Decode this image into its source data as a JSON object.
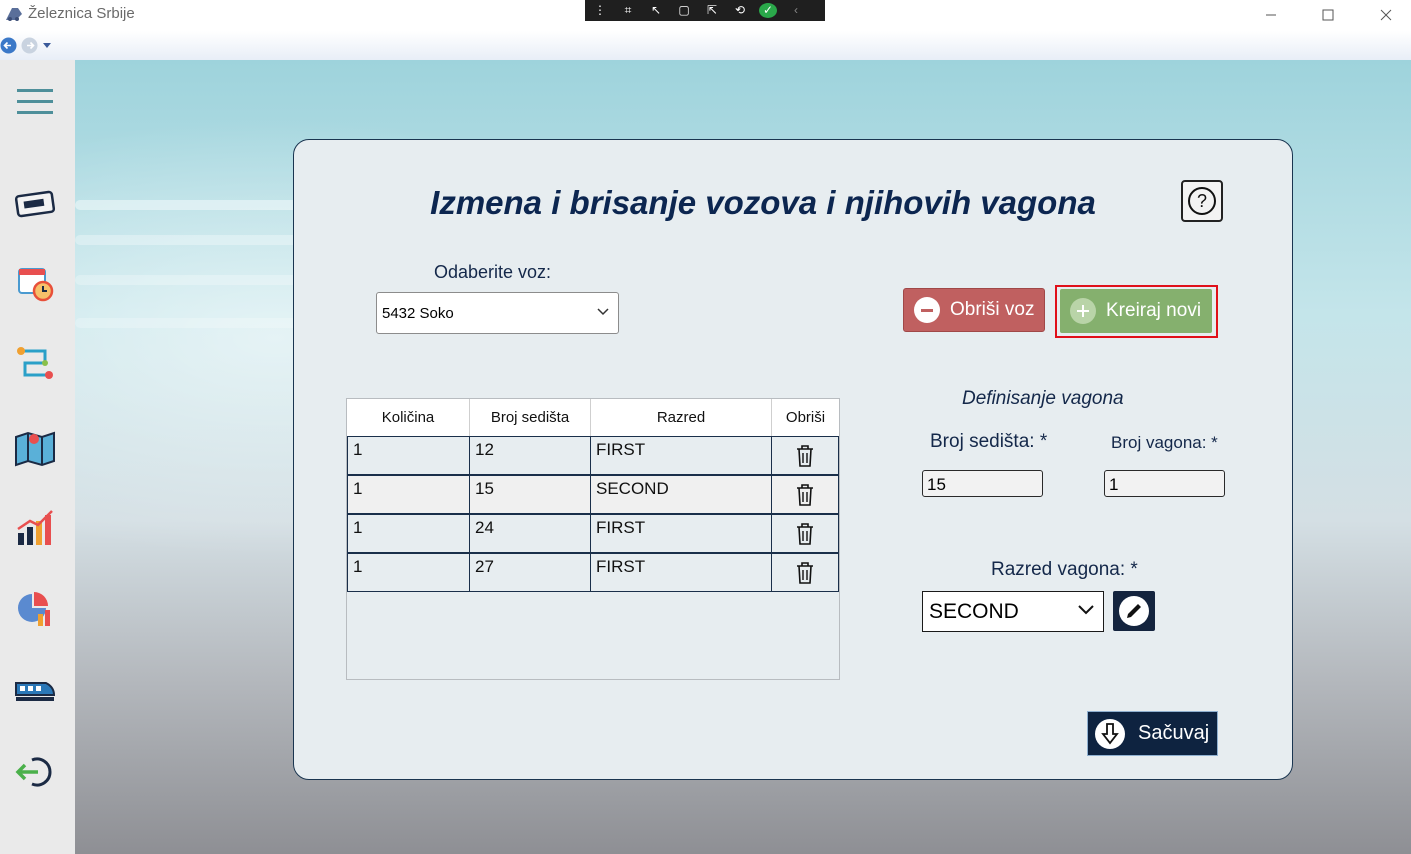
{
  "window": {
    "title": "Železnica Srbije"
  },
  "page": {
    "heading": "Izmena i brisanje vozova i njihovih vagona",
    "help_label": "?"
  },
  "train_select": {
    "label": "Odaberite voz:",
    "value": "5432 Soko"
  },
  "actions": {
    "delete_train": "Obriši voz",
    "create_new": "Kreiraj novi",
    "save": "Sačuvaj"
  },
  "table": {
    "columns": [
      "Količina",
      "Broj sedišta",
      "Razred",
      "Obriši"
    ],
    "rows": [
      {
        "kolicina": "1",
        "broj_sedista": "12",
        "razred": "FIRST"
      },
      {
        "kolicina": "1",
        "broj_sedista": "15",
        "razred": "SECOND"
      },
      {
        "kolicina": "1",
        "broj_sedista": "24",
        "razred": "FIRST"
      },
      {
        "kolicina": "1",
        "broj_sedista": "27",
        "razred": "FIRST"
      }
    ]
  },
  "wagon_form": {
    "title": "Definisanje vagona",
    "seats_label": "Broj sedišta: *",
    "seats_value": "15",
    "wagon_no_label": "Broj vagona: *",
    "wagon_no_value": "1",
    "class_label": "Razred vagona: *",
    "class_value": "SECOND"
  },
  "colors": {
    "heading": "#0c2650",
    "delete_button": "#c06060",
    "create_button": "#85b06e",
    "highlight_outline": "#e0101a",
    "dark_button": "#0e2340"
  },
  "sidebar_icons": [
    "menu-icon",
    "ticket-icon",
    "calendar-clock-icon",
    "route-icon",
    "map-icon",
    "bar-chart-icon",
    "pie-chart-icon",
    "train-icon",
    "logout-icon"
  ]
}
